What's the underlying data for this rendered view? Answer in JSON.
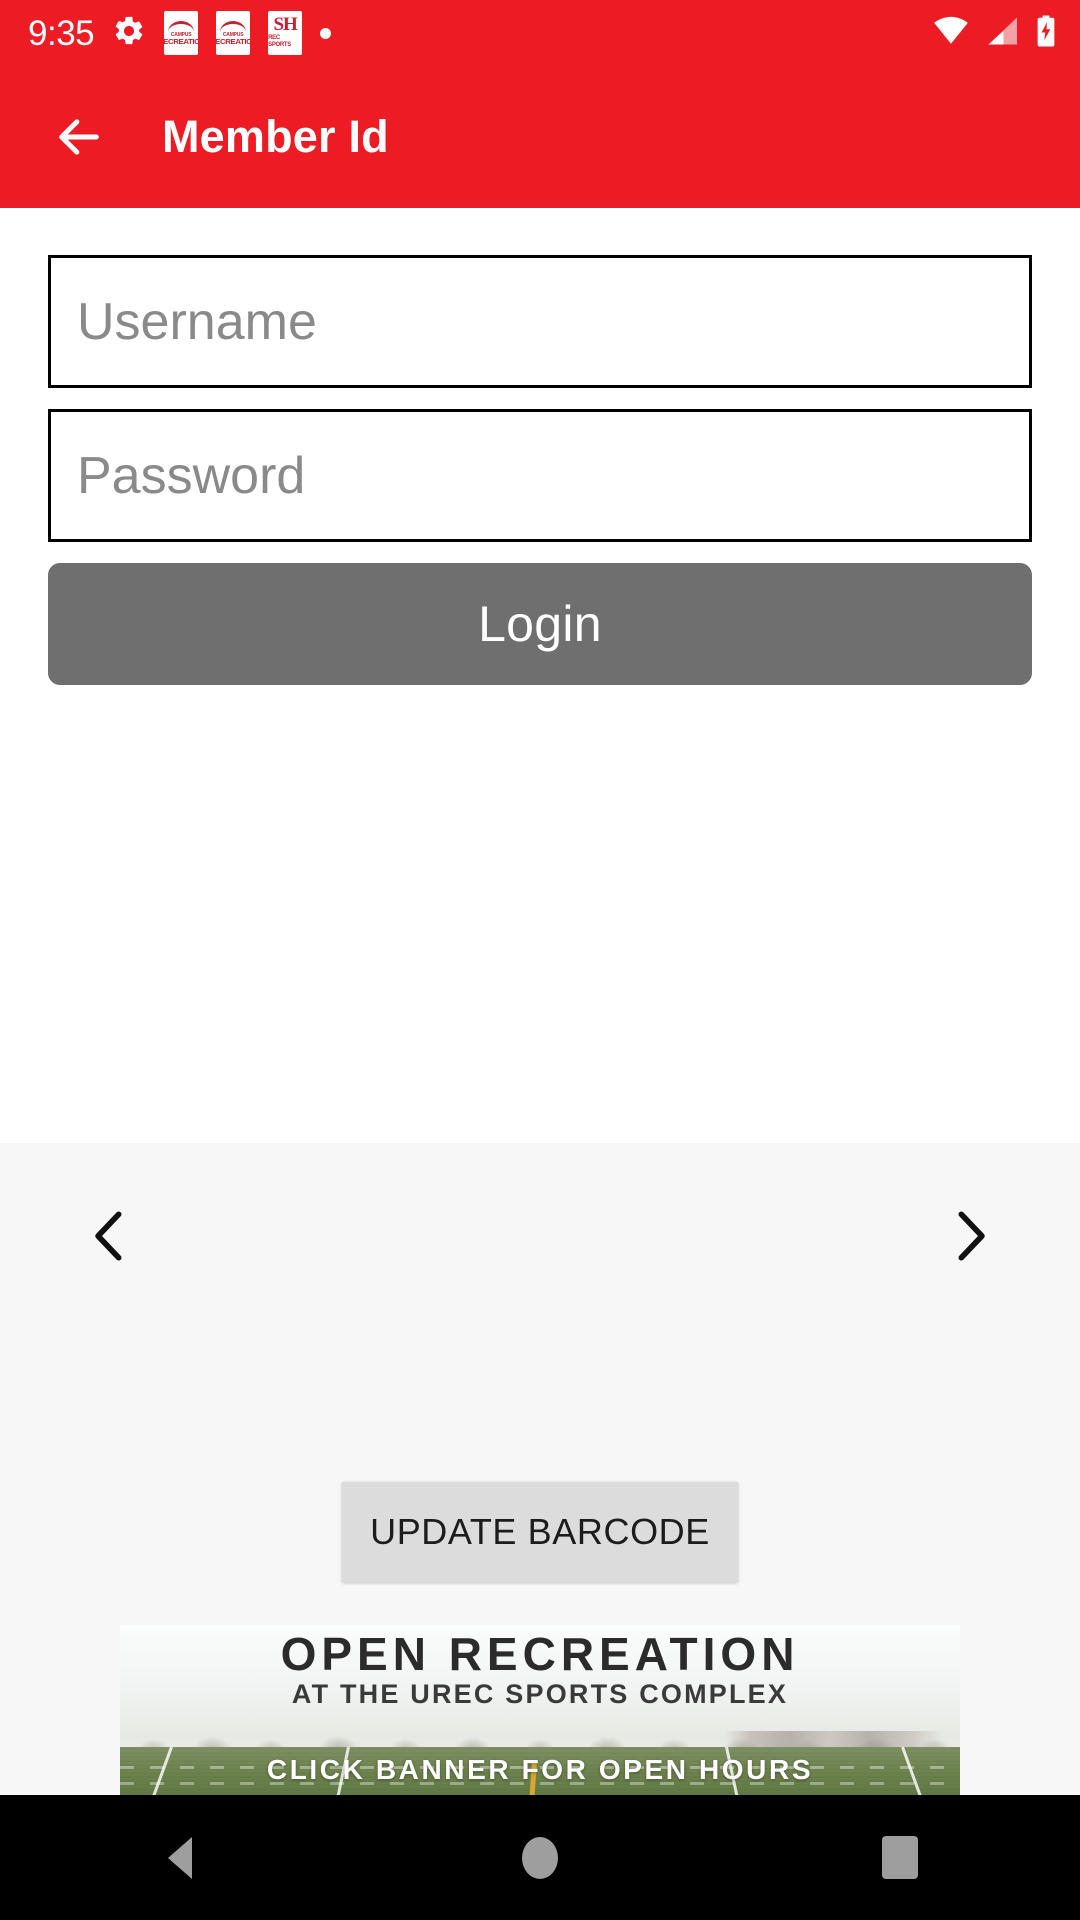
{
  "status_bar": {
    "time": "9:35",
    "icons": [
      {
        "name": "settings-gear-icon",
        "label": "gear"
      },
      {
        "name": "campus-recreation-icon-1",
        "line1": "CAMPUS",
        "line2": "RECREATION"
      },
      {
        "name": "campus-recreation-icon-2",
        "line1": "CAMPUS",
        "line2": "RECREATION"
      },
      {
        "name": "sh-rec-sports-icon",
        "mark": "SH",
        "sub": "REC SPORTS"
      },
      {
        "name": "notification-dot-icon",
        "label": "dot"
      }
    ],
    "right_icons": [
      {
        "name": "wifi-icon",
        "label": "wifi-full"
      },
      {
        "name": "cell-signal-icon",
        "label": "signal-2-of-4"
      },
      {
        "name": "battery-charging-icon",
        "label": "battery-charging"
      }
    ]
  },
  "app_bar": {
    "back_label": "Back",
    "title": "Member Id"
  },
  "form": {
    "username": {
      "placeholder": "Username",
      "value": ""
    },
    "password": {
      "placeholder": "Password",
      "value": ""
    },
    "login_label": "Login"
  },
  "carousel": {
    "prev_label": "Previous",
    "next_label": "Next"
  },
  "barcode": {
    "update_label": "UPDATE BARCODE"
  },
  "banner": {
    "title": "OPEN RECREATION",
    "subtitle": "AT THE UREC SPORTS COMPLEX",
    "cta": "CLICK BANNER FOR OPEN HOURS"
  },
  "nav_bar": {
    "back_label": "Back",
    "home_label": "Home",
    "recents_label": "Recents"
  },
  "colors": {
    "brand_red": "#ED1C24",
    "login_gray": "#706F6F",
    "panel_gray": "#f7f7f7",
    "barcode_gray": "#dcdcdc",
    "nav_black": "#000000"
  }
}
